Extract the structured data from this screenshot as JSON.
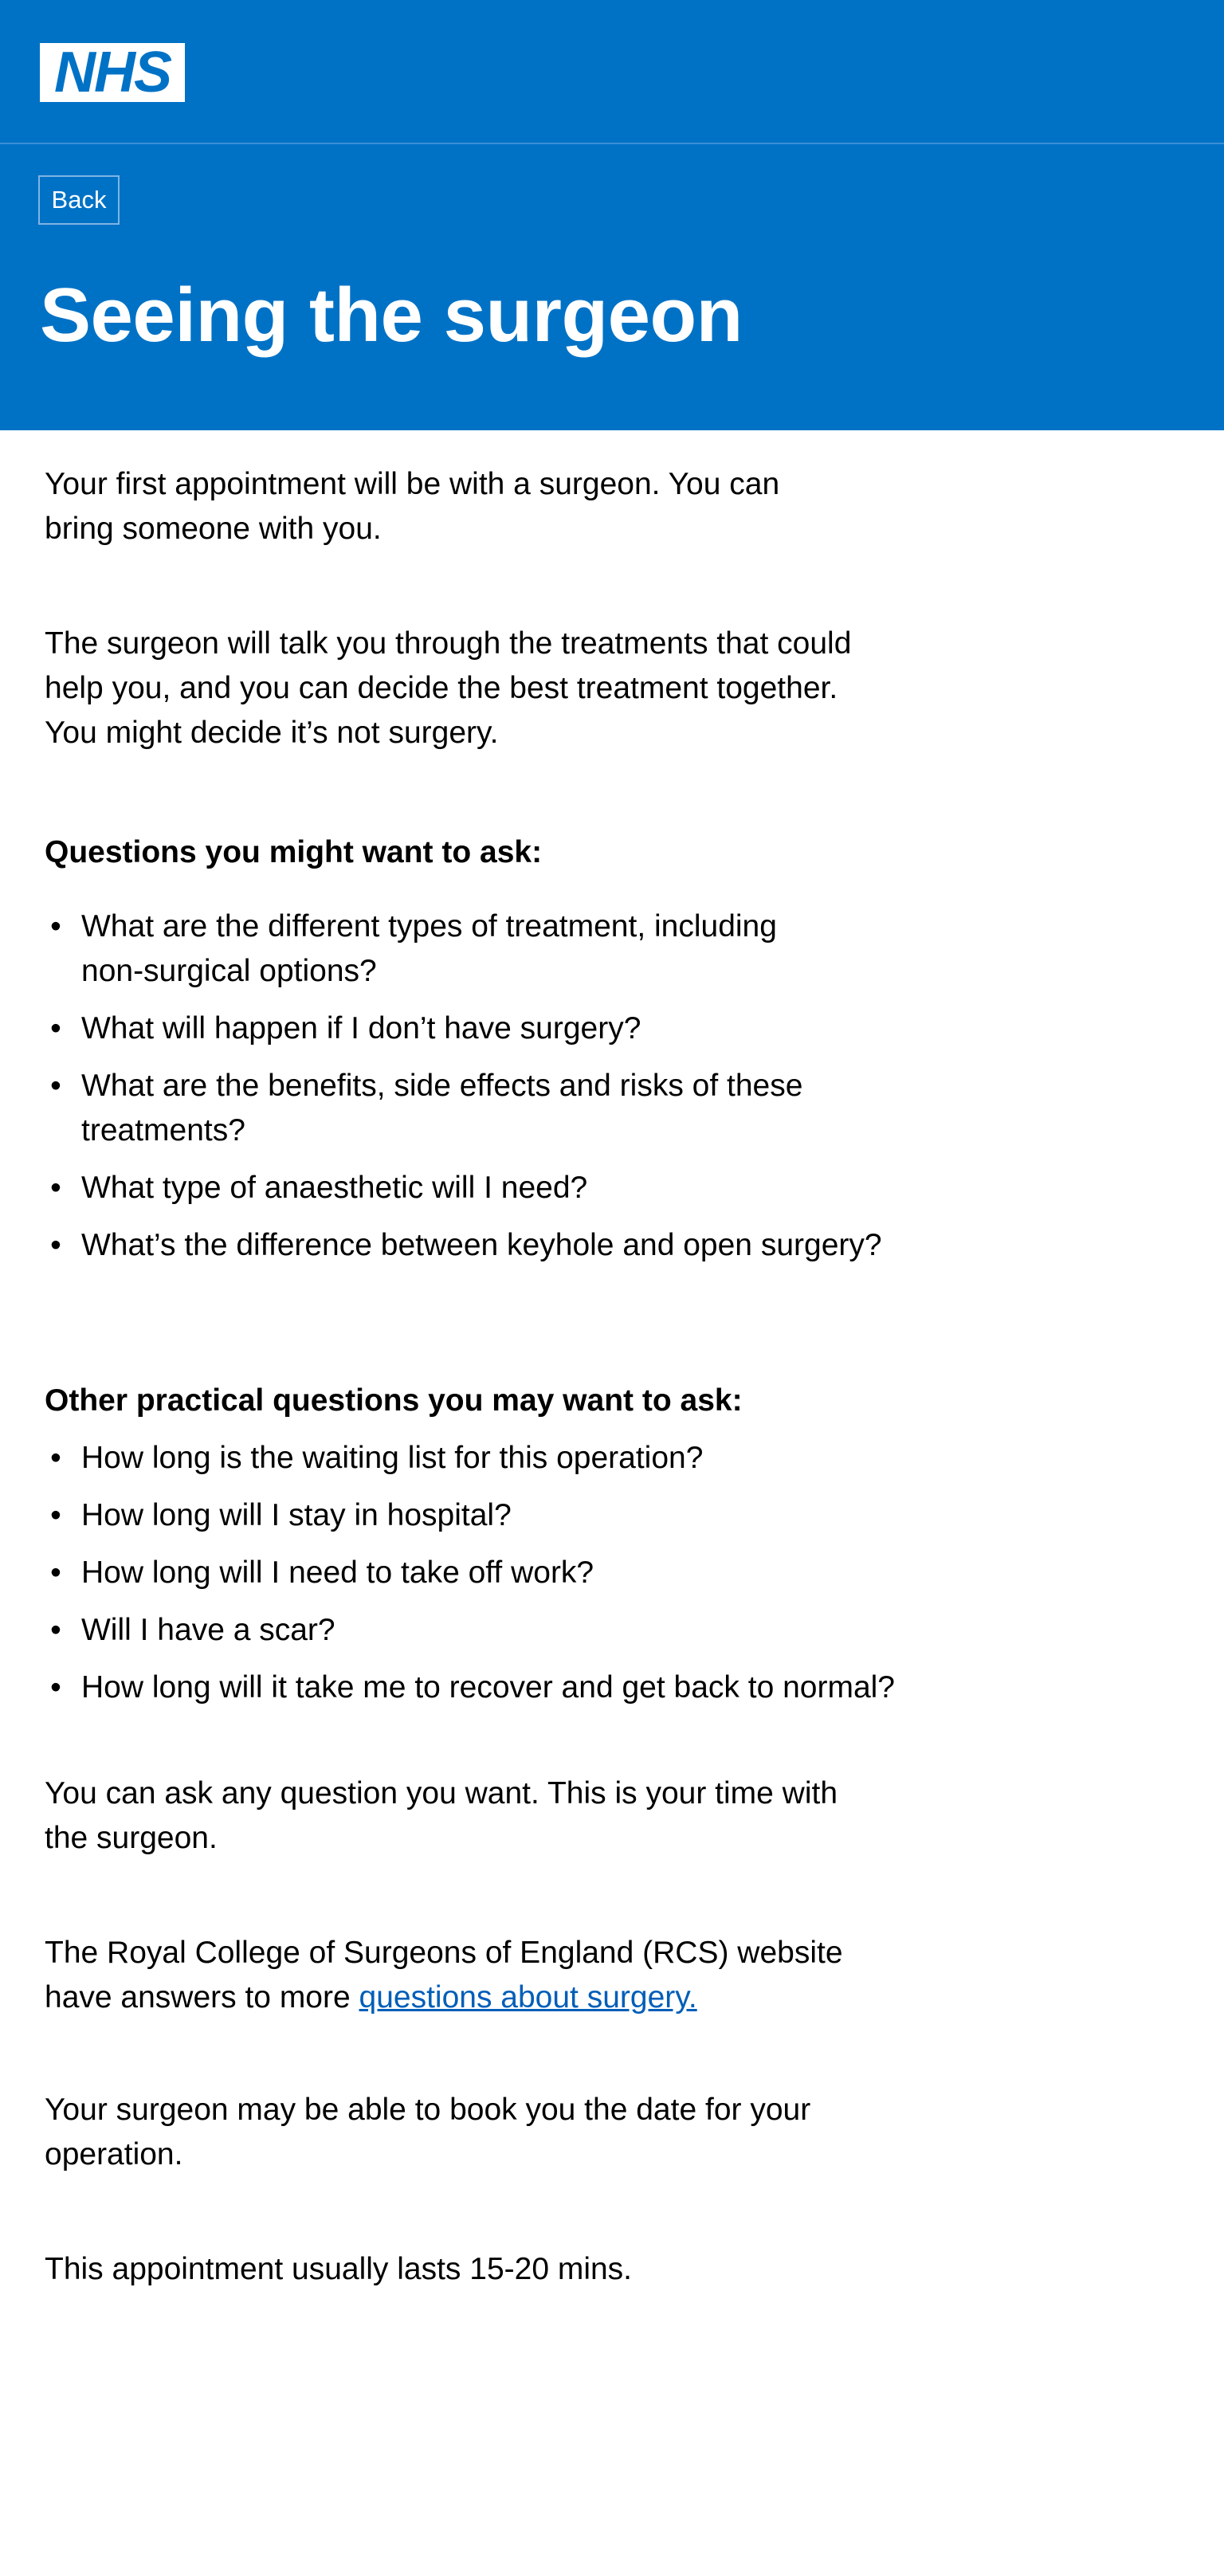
{
  "header": {
    "logo_text": "NHS",
    "back_label": "Back",
    "title": "Seeing the surgeon",
    "background_color": "#0072c6"
  },
  "intro": {
    "p1": "Your first appointment will be with a surgeon. You can bring someone with you.",
    "p2": "The surgeon will talk you through the treatments that could help you, and you can decide the best treatment together.  You might decide it’s not surgery."
  },
  "questions": {
    "heading": "Questions you might want to ask:",
    "items": [
      "What are the different types of treatment, including non-surgical options?",
      "What will happen if I don’t have surgery?",
      "What are the benefits, side effects and risks of these treatments?",
      "What type of anaesthetic will I need?",
      "What’s the difference between keyhole and open surgery?"
    ]
  },
  "practical": {
    "heading": "Other practical questions you may want to ask:",
    "items": [
      "How long is the waiting list for this operation?",
      "How long will I stay in hospital?",
      "How long will I need to take off work?",
      "Will I have a scar?",
      "How long will it take me to recover and get back to normal?"
    ]
  },
  "closing": {
    "p1": "You can ask any question you want. This is your time with the surgeon.",
    "p2_before_link": "The Royal College of Surgeons of England (RCS) website have answers to more ",
    "p2_link": "questions about surgery.",
    "p3": "Your surgeon may be able to book you the date for your operation.",
    "p4": "This appointment usually lasts 15-20 mins.",
    "link_color": "#005eb8"
  }
}
